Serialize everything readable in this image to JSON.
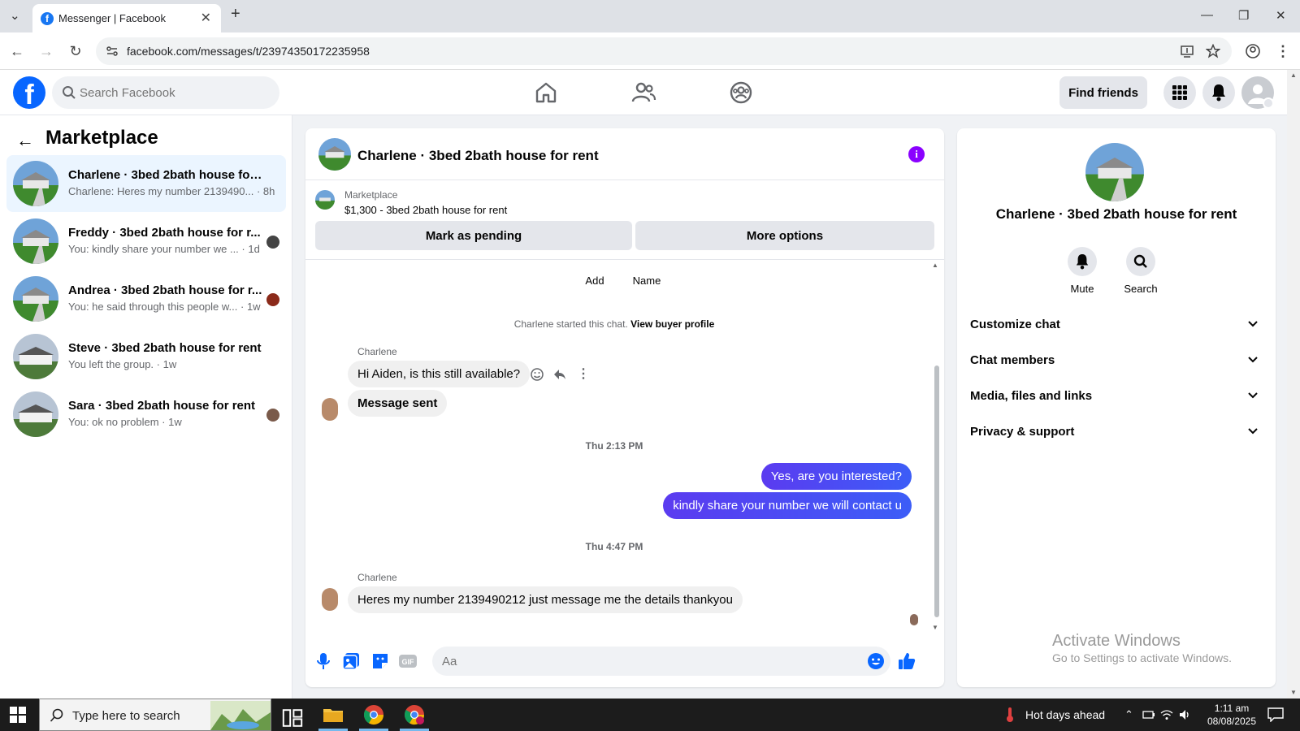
{
  "browser": {
    "tab_title": "Messenger | Facebook",
    "url": "facebook.com/messages/t/23974350172235958"
  },
  "header": {
    "search_placeholder": "Search Facebook",
    "find_friends": "Find friends"
  },
  "sidebar": {
    "title": "Marketplace",
    "conversations": [
      {
        "name": "Charlene · 3bed 2bath house for r...",
        "preview": "Charlene: Heres my number 2139490... · 8h",
        "active": true
      },
      {
        "name": "Freddy · 3bed 2bath house for r...",
        "preview": "You: kindly share your number we ... · 1d"
      },
      {
        "name": "Andrea · 3bed 2bath house for r...",
        "preview": "You: he said through this people w... · 1w"
      },
      {
        "name": "Steve · 3bed 2bath house for rent",
        "preview": "You left the group. · 1w"
      },
      {
        "name": "Sara · 3bed 2bath house for rent",
        "preview": "You: ok no problem · 1w"
      }
    ]
  },
  "chat": {
    "title": "Charlene · 3bed 2bath house for rent",
    "listing_source": "Marketplace",
    "listing_item": "$1,300 - 3bed 2bath house for rent",
    "mark_pending": "Mark as pending",
    "more_options": "More options",
    "top_actions": {
      "add": "Add",
      "name": "Name"
    },
    "started_text": "Charlene started this chat.",
    "view_profile": "View buyer profile",
    "sender_name": "Charlene",
    "messages": {
      "m1": "Hi Aiden, is this still available?",
      "m2": "Message sent",
      "ts1": "Thu 2:13 PM",
      "m3": "Yes, are you interested?",
      "m4": "kindly share your number we will contact u",
      "ts2": "Thu 4:47 PM",
      "m5": "Heres my number 2139490212 just message me the details thankyou"
    },
    "composer_placeholder": "Aa"
  },
  "details": {
    "name": "Charlene · 3bed 2bath house for rent",
    "mute": "Mute",
    "search": "Search",
    "sections": [
      "Customize chat",
      "Chat members",
      "Media, files and links",
      "Privacy & support"
    ]
  },
  "watermark": {
    "line1": "Activate Windows",
    "line2": "Go to Settings to activate Windows."
  },
  "taskbar": {
    "search_text": "Type here to search",
    "weather": "Hot days ahead",
    "time": "1:11 am",
    "date": "08/08/2025"
  },
  "colors": {
    "brand": "#0866ff",
    "outgoing_bubble": "#4a48f2",
    "info": "#8a01ff"
  }
}
